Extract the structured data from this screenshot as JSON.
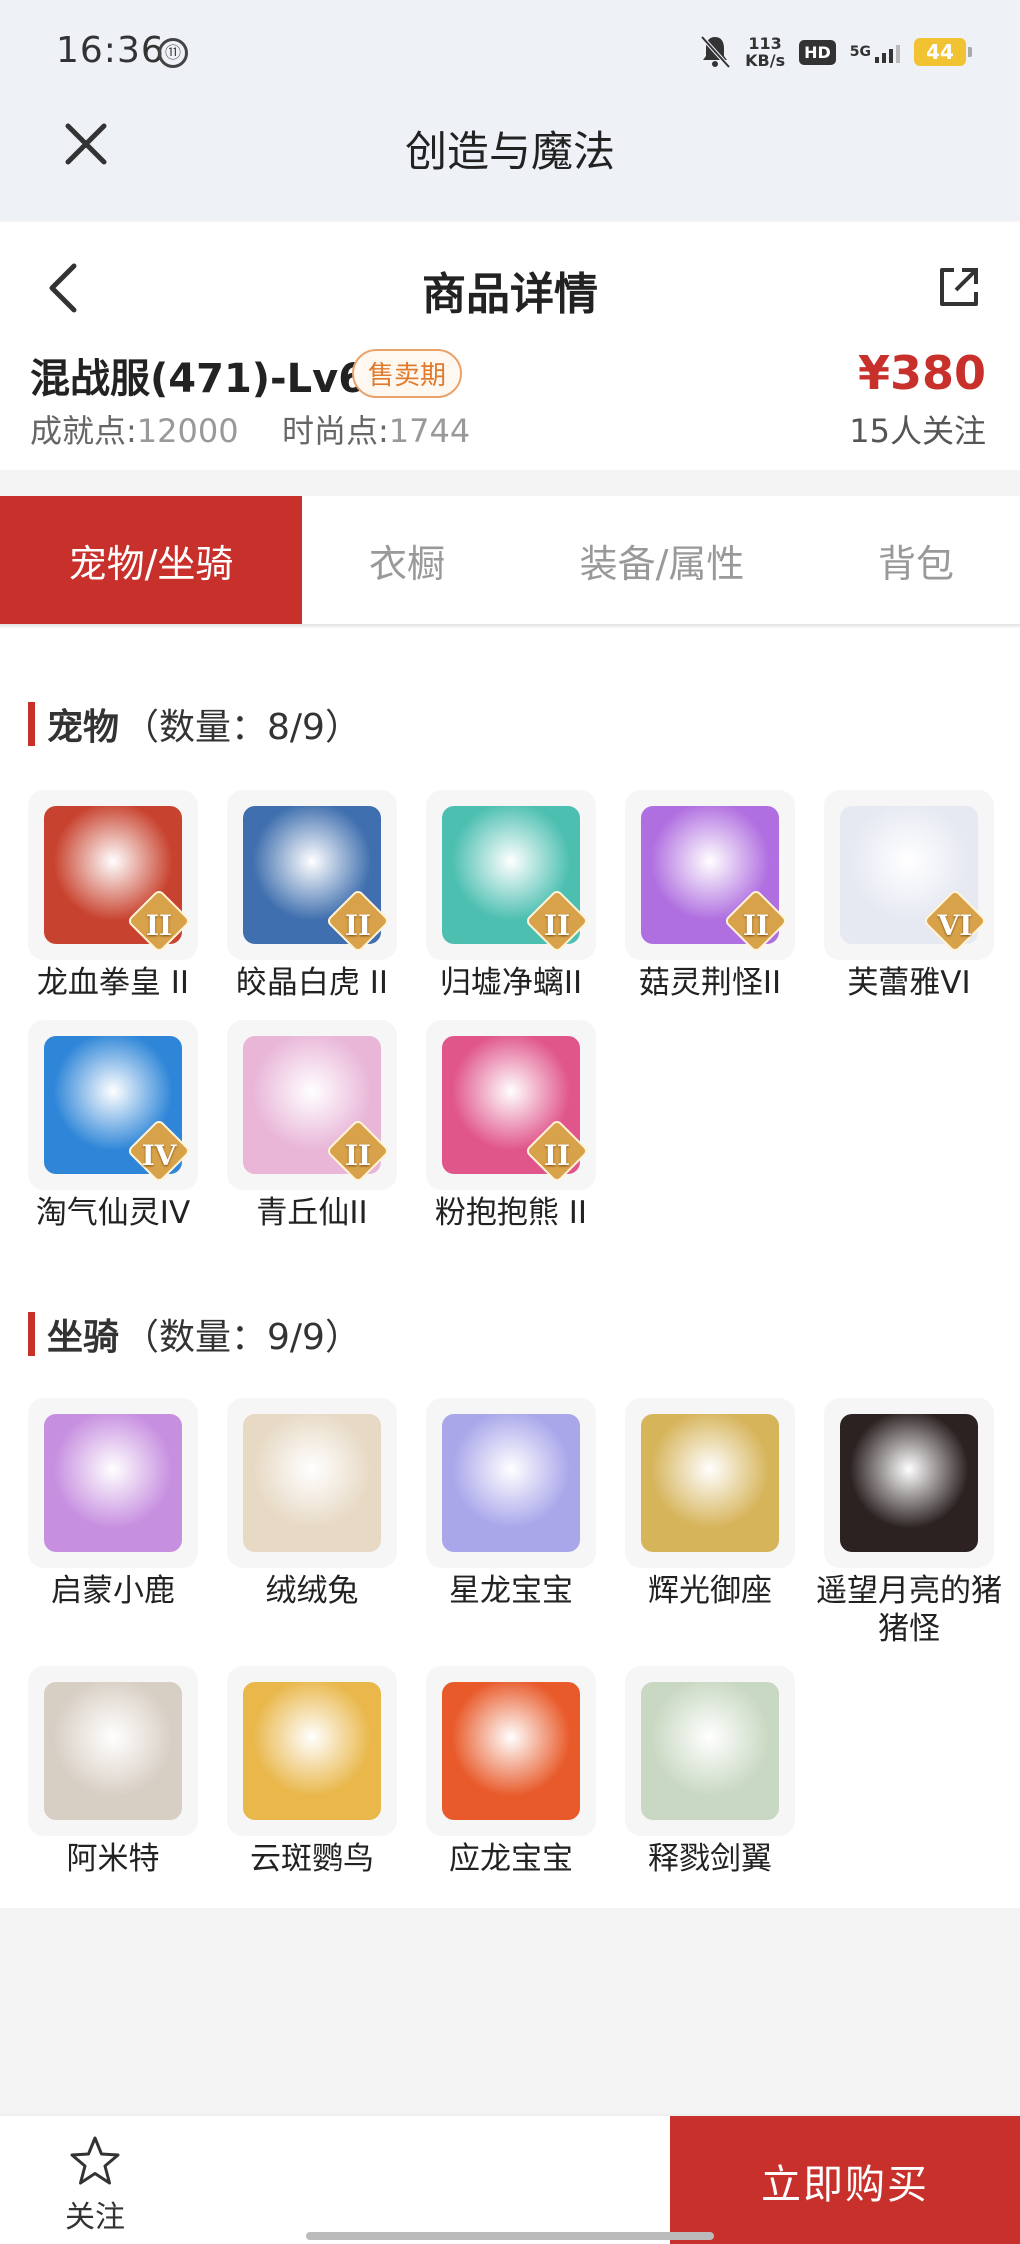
{
  "status_bar": {
    "time": "16:36",
    "net_speed_value": "113",
    "net_speed_unit": "KB/s",
    "hd": "HD",
    "signal": "5G",
    "battery": "44"
  },
  "app_header": {
    "title": "创造与魔法"
  },
  "detail": {
    "page_title": "商品详情",
    "server_name": "混战服(471)-Lv69",
    "badge": "售卖期",
    "price": "¥380",
    "achievement_label": "成就点:",
    "achievement_value": "12000",
    "fashion_label": "时尚点:",
    "fashion_value": "1744",
    "followers": "15人关注"
  },
  "tabs": [
    {
      "label": "宠物/坐骑",
      "active": true
    },
    {
      "label": "衣橱",
      "active": false
    },
    {
      "label": "装备/属性",
      "active": false
    },
    {
      "label": "背包",
      "active": false
    }
  ],
  "pets": {
    "title": "宠物",
    "count": "（数量：8/9）",
    "items": [
      {
        "name": "龙血拳皇 II",
        "tier": "II",
        "color": "#c8432f"
      },
      {
        "name": "皎晶白虎 II",
        "tier": "II",
        "color": "#3f6fae"
      },
      {
        "name": "归墟净螭II",
        "tier": "II",
        "color": "#4cbfb1"
      },
      {
        "name": "菇灵荆怪II",
        "tier": "II",
        "color": "#b06fe0"
      },
      {
        "name": "芙蕾雅VI",
        "tier": "VI",
        "color": "#e6e9f2"
      },
      {
        "name": "淘气仙灵IV",
        "tier": "IV",
        "color": "#2f86d8"
      },
      {
        "name": "青丘仙II",
        "tier": "II",
        "color": "#e9b6d8"
      },
      {
        "name": "粉抱抱熊 II",
        "tier": "II",
        "color": "#e0558a"
      }
    ]
  },
  "mounts": {
    "title": "坐骑",
    "count": "（数量：9/9）",
    "items": [
      {
        "name": "启蒙小鹿",
        "color": "#c78fe0"
      },
      {
        "name": "绒绒兔",
        "color": "#e7d9c4"
      },
      {
        "name": "星龙宝宝",
        "color": "#a9a6ea"
      },
      {
        "name": "辉光御座",
        "color": "#d6b45a"
      },
      {
        "name": "遥望月亮的猪猪怪",
        "color": "#2c2222"
      },
      {
        "name": "阿米特",
        "color": "#d8cfc4"
      },
      {
        "name": "云斑鹦鸟",
        "color": "#e9b74a"
      },
      {
        "name": "应龙宝宝",
        "color": "#e85a2a"
      },
      {
        "name": "释戮剑翼",
        "color": "#c9d8c2"
      }
    ]
  },
  "bottom": {
    "follow_label": "关注",
    "buy_label": "立即购买"
  },
  "colors": {
    "accent": "#c8302b",
    "badge": "#e07a2c"
  }
}
